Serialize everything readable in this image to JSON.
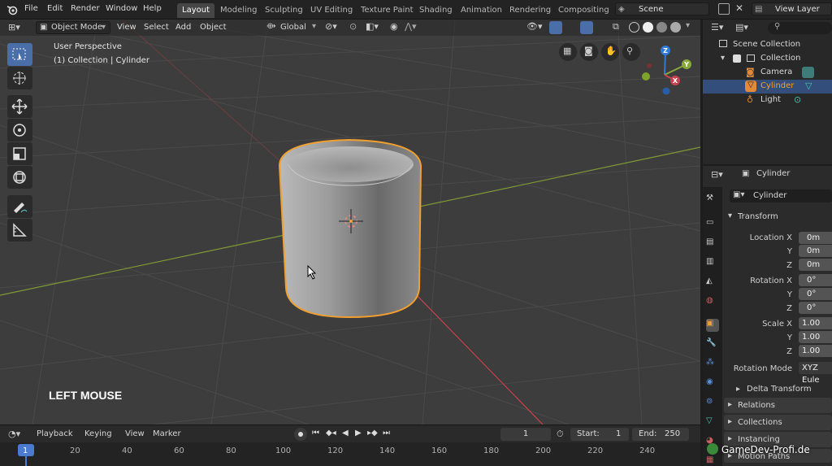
{
  "menu": [
    "File",
    "Edit",
    "Render",
    "Window",
    "Help"
  ],
  "workspaces": [
    {
      "label": "Layout",
      "active": true
    },
    {
      "label": "Modeling"
    },
    {
      "label": "Sculpting"
    },
    {
      "label": "UV Editing"
    },
    {
      "label": "Texture Paint"
    },
    {
      "label": "Shading"
    },
    {
      "label": "Animation"
    },
    {
      "label": "Rendering"
    },
    {
      "label": "Compositing"
    }
  ],
  "scene": {
    "name": "Scene",
    "view_layer": "View Layer"
  },
  "viewport": {
    "mode": "Object Mode",
    "menus": [
      "View",
      "Select",
      "Add",
      "Object"
    ],
    "transform_orientation": "Global",
    "perspective": "User Perspective",
    "context": "(1) Collection | Cylinder",
    "overlay_hint": "LEFT MOUSE",
    "gizmo_axes": [
      "X",
      "Y",
      "Z"
    ],
    "colors": {
      "bg": "#3d3d3d",
      "selection": "#f0a030",
      "x_axis": "#c8424f",
      "y_axis": "#88a83a",
      "z_axis": "#2f7ad6"
    }
  },
  "timeline": {
    "menus": [
      "Playback",
      "Keying",
      "View",
      "Marker"
    ],
    "current_frame": "1",
    "start_label": "Start:",
    "start": "1",
    "end_label": "End:",
    "end": "250",
    "ticks": [
      "1",
      "20",
      "40",
      "60",
      "80",
      "100",
      "120",
      "140",
      "160",
      "180",
      "200",
      "220",
      "240"
    ]
  },
  "outliner": {
    "root": "Scene Collection",
    "collection": "Collection",
    "objects": [
      {
        "name": "Camera",
        "icon": "camera-icon"
      },
      {
        "name": "Cylinder",
        "icon": "mesh-icon",
        "selected": true
      },
      {
        "name": "Light",
        "icon": "light-icon"
      }
    ]
  },
  "properties": {
    "object_name": "Cylinder",
    "datablock_name": "Cylinder",
    "transform_title": "Transform",
    "location": {
      "label": "Location X",
      "x": "0m",
      "y": "0m",
      "z": "0m"
    },
    "rotation": {
      "label": "Rotation X",
      "x": "0°",
      "y": "0°",
      "z": "0°"
    },
    "scale": {
      "label": "Scale X",
      "x": "1.00",
      "y": "1.00",
      "z": "1.00"
    },
    "axis_labels": {
      "y": "Y",
      "z": "Z"
    },
    "rotation_mode_label": "Rotation Mode",
    "rotation_mode": "XYZ Eule",
    "subsections": [
      "Delta Transform"
    ],
    "panels": [
      "Relations",
      "Collections",
      "Instancing",
      "Motion Paths"
    ]
  },
  "watermark": "GameDev-Profi.de"
}
